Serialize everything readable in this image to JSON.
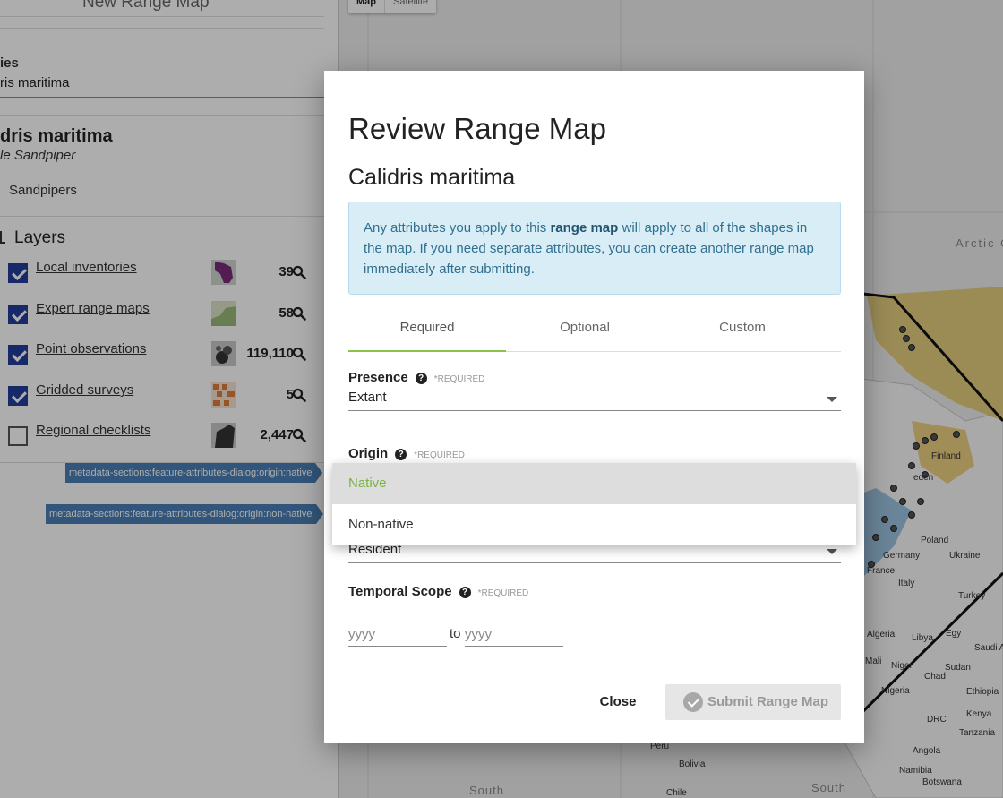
{
  "sidebar": {
    "title": "New Range Map",
    "species_label": "ies",
    "species_input_value": "ris maritima",
    "scientific_name": "dris maritima",
    "common_name": "le Sandpiper",
    "group": "Sandpipers",
    "layers_heading": "Layers",
    "layers": [
      {
        "name": "Local inventories",
        "checked": true,
        "count": "39",
        "icon": "polygon-thumbnail"
      },
      {
        "name": "Expert range maps",
        "checked": true,
        "count": "58",
        "icon": "range-thumbnail"
      },
      {
        "name": "Point observations",
        "checked": true,
        "count": "119,110",
        "icon": "points-thumbnail"
      },
      {
        "name": "Gridded surveys",
        "checked": true,
        "count": "5",
        "icon": "grid-thumbnail"
      },
      {
        "name": "Regional checklists",
        "checked": false,
        "count": "2,447",
        "icon": "checklist-thumbnail"
      }
    ],
    "tags": [
      "metadata-sections:feature-attributes-dialog:origin:native",
      "metadata-sections:feature-attributes-dialog:origin:non-native"
    ]
  },
  "map": {
    "buttons": {
      "map": "Map",
      "satellite": "Satellite"
    },
    "labels": {
      "arctic": "Arctic O",
      "finland": "Finland",
      "sweden": "eden",
      "germany": "Germany",
      "poland": "Poland",
      "ukraine": "Ukraine",
      "france": "France",
      "italy": "Italy",
      "turkey": "Turkey",
      "algeria": "Algeria",
      "libya": "Libya",
      "egypt": "Egy",
      "saudi": "Saudi A",
      "mali": "Mali",
      "niger": "Niger",
      "chad": "Chad",
      "sudan": "Sudan",
      "nigeria": "Nigeria",
      "ethiopia": "Ethiopia",
      "drc": "DRC",
      "kenya": "Kenya",
      "tanzania": "Tanzania",
      "angola": "Angola",
      "namibia": "Namibia",
      "botswana": "Botswana",
      "peru": "Peru",
      "bolivia": "Bolivia",
      "chile": "Chile",
      "south1": "South",
      "south2": "South"
    }
  },
  "dialog": {
    "title": "Review Range Map",
    "subtitle": "Calidris maritima",
    "info_pre": "Any attributes you apply to this ",
    "info_bold": "range map",
    "info_post": " will apply to all of the shapes in the map. If you need separate attributes, you can create another range map immediately after submitting.",
    "tabs": [
      "Required",
      "Optional",
      "Custom"
    ],
    "active_tab": "Required",
    "presence": {
      "label": "Presence",
      "required": "*REQUIRED",
      "value": "Extant"
    },
    "origin": {
      "label": "Origin",
      "required": "*REQUIRED"
    },
    "seasonality": {
      "value": "Resident"
    },
    "temporal_scope": {
      "label": "Temporal Scope",
      "required": "*REQUIRED",
      "from_placeholder": "yyyy",
      "to_label": "to",
      "to_placeholder": "yyyy"
    },
    "close_label": "Close",
    "submit_label": "Submit Range Map"
  },
  "origin_menu": {
    "options": [
      "Native",
      "Non-native"
    ],
    "selected": "Native"
  }
}
